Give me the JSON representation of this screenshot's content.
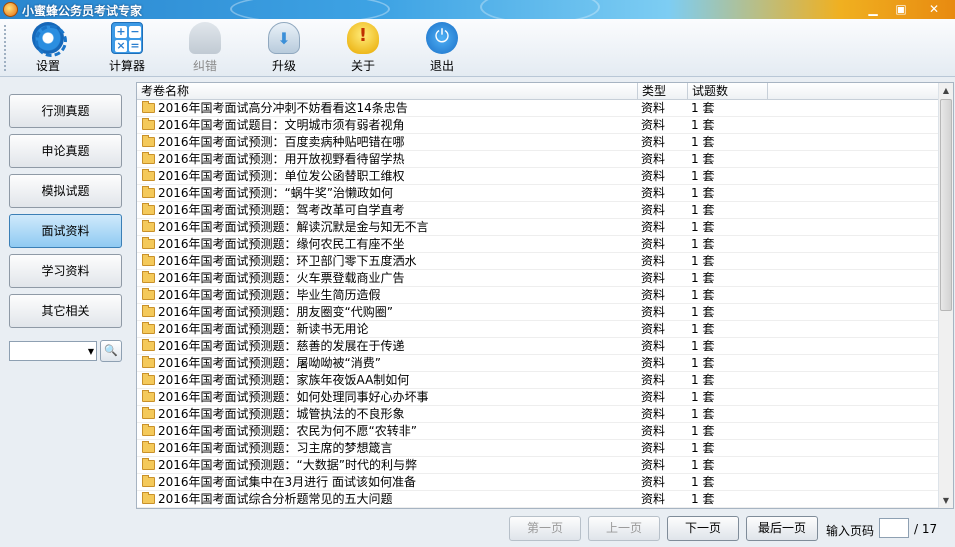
{
  "window": {
    "title": "小蜜蜂公务员考试专家",
    "min_symbol": "▁",
    "max_symbol": "▣",
    "close_symbol": "✕"
  },
  "toolbar": {
    "items": [
      {
        "label": "设置",
        "icon": "gear-icon",
        "enabled": true
      },
      {
        "label": "计算器",
        "icon": "calculator-icon",
        "enabled": true
      },
      {
        "label": "纠错",
        "icon": "person-icon",
        "enabled": false
      },
      {
        "label": "升级",
        "icon": "cloud-download-icon",
        "enabled": true
      },
      {
        "label": "关于",
        "icon": "info-bulb-icon",
        "enabled": true
      },
      {
        "label": "退出",
        "icon": "power-icon",
        "enabled": true
      }
    ]
  },
  "sidebar": {
    "items": [
      {
        "label": "行测真题",
        "active": false
      },
      {
        "label": "申论真题",
        "active": false
      },
      {
        "label": "模拟试题",
        "active": false
      },
      {
        "label": "面试资料",
        "active": true
      },
      {
        "label": "学习资料",
        "active": false
      },
      {
        "label": "其它相关",
        "active": false
      }
    ],
    "combo_value": "",
    "combo_arrow": "▼",
    "search_symbol": "🔍"
  },
  "table": {
    "headers": {
      "name": "考卷名称",
      "type": "类型",
      "count": "试题数"
    },
    "rows": [
      {
        "name": "2016年国考面试高分冲刺不妨看看这14条忠告",
        "type": "资料",
        "count": "1 套"
      },
      {
        "name": "2016年国考面试题目：文明城市须有弱者视角",
        "type": "资料",
        "count": "1 套"
      },
      {
        "name": "2016年国考面试预测：百度卖病种贴吧错在哪",
        "type": "资料",
        "count": "1 套"
      },
      {
        "name": "2016年国考面试预测：用开放视野看待留学热",
        "type": "资料",
        "count": "1 套"
      },
      {
        "name": "2016年国考面试预测：单位发公函替职工维权",
        "type": "资料",
        "count": "1 套"
      },
      {
        "name": "2016年国考面试预测：“蜗牛奖”治懒政如何",
        "type": "资料",
        "count": "1 套"
      },
      {
        "name": "2016年国考面试预测题：驾考改革可自学直考",
        "type": "资料",
        "count": "1 套"
      },
      {
        "name": "2016年国考面试预测题：解读沉默是金与知无不言",
        "type": "资料",
        "count": "1 套"
      },
      {
        "name": "2016年国考面试预测题：缘何农民工有座不坐",
        "type": "资料",
        "count": "1 套"
      },
      {
        "name": "2016年国考面试预测题：环卫部门零下五度洒水",
        "type": "资料",
        "count": "1 套"
      },
      {
        "name": "2016年国考面试预测题：火车票登载商业广告",
        "type": "资料",
        "count": "1 套"
      },
      {
        "name": "2016年国考面试预测题：毕业生简历造假",
        "type": "资料",
        "count": "1 套"
      },
      {
        "name": "2016年国考面试预测题：朋友圈变“代购圈”",
        "type": "资料",
        "count": "1 套"
      },
      {
        "name": "2016年国考面试预测题：新读书无用论",
        "type": "资料",
        "count": "1 套"
      },
      {
        "name": "2016年国考面试预测题：慈善的发展在于传递",
        "type": "资料",
        "count": "1 套"
      },
      {
        "name": "2016年国考面试预测题：屠呦呦被“消费”",
        "type": "资料",
        "count": "1 套"
      },
      {
        "name": "2016年国考面试预测题：家族年夜饭AA制如何",
        "type": "资料",
        "count": "1 套"
      },
      {
        "name": "2016年国考面试预测题：如何处理同事好心办坏事",
        "type": "资料",
        "count": "1 套"
      },
      {
        "name": "2016年国考面试预测题：城管执法的不良形象",
        "type": "资料",
        "count": "1 套"
      },
      {
        "name": "2016年国考面试预测题：农民为何不愿“农转非”",
        "type": "资料",
        "count": "1 套"
      },
      {
        "name": "2016年国考面试预测题：习主席的梦想箴言",
        "type": "资料",
        "count": "1 套"
      },
      {
        "name": "2016年国考面试预测题：“大数据”时代的利与弊",
        "type": "资料",
        "count": "1 套"
      },
      {
        "name": "2016年国考面试集中在3月进行 面试该如何准备",
        "type": "资料",
        "count": "1 套"
      },
      {
        "name": "2016年国考面试综合分析题常见的五大问题",
        "type": "资料",
        "count": "1 套"
      }
    ],
    "scroll_up": "▲",
    "scroll_down": "▼"
  },
  "pager": {
    "first": "第一页",
    "prev": "上一页",
    "next": "下一页",
    "last": "最后一页",
    "input_label": "输入页码",
    "page_input": "",
    "total_text": "/ 17"
  }
}
